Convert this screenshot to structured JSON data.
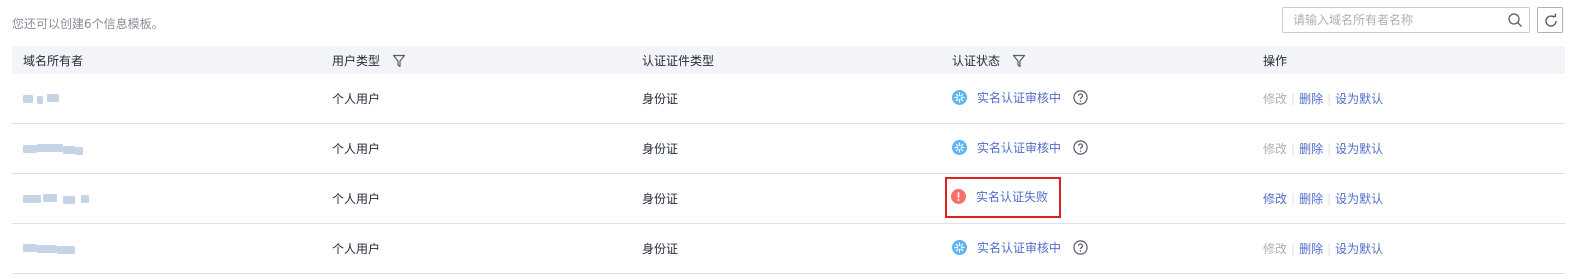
{
  "toolbar": {
    "quota_text": "您还可以创建6个信息模板。",
    "search_placeholder": "请输入域名所有者名称",
    "search_value": ""
  },
  "table": {
    "headers": {
      "owner": "域名所有者",
      "user_type": "用户类型",
      "cert_type": "认证证件类型",
      "cert_status": "认证状态",
      "actions": "操作"
    },
    "rows": [
      {
        "user_type": "个人用户",
        "cert_type": "身份证",
        "status": "实名认证审核中",
        "status_kind": "pending",
        "edit": "修改",
        "delete": "删除",
        "set_default": "设为默认"
      },
      {
        "user_type": "个人用户",
        "cert_type": "身份证",
        "status": "实名认证审核中",
        "status_kind": "pending",
        "edit": "修改",
        "delete": "删除",
        "set_default": "设为默认"
      },
      {
        "user_type": "个人用户",
        "cert_type": "身份证",
        "status": "实名认证失败",
        "status_kind": "failed",
        "edit": "修改",
        "delete": "删除",
        "set_default": "设为默认"
      },
      {
        "user_type": "个人用户",
        "cert_type": "身份证",
        "status": "实名认证审核中",
        "status_kind": "pending",
        "edit": "修改",
        "delete": "删除",
        "set_default": "设为默认"
      }
    ]
  },
  "icons": {
    "pending": "spinner-icon",
    "failed": "error-icon",
    "help": "help-circle-icon",
    "filter": "filter-icon",
    "search": "search-icon",
    "refresh": "refresh-icon"
  },
  "colors": {
    "pending_icon": "#5bb5f2",
    "failed_icon": "#f66f6a",
    "link": "#526ecc",
    "disabled": "#adb0b8",
    "highlight_border": "#e02020",
    "header_bg": "#f3f4f7"
  }
}
